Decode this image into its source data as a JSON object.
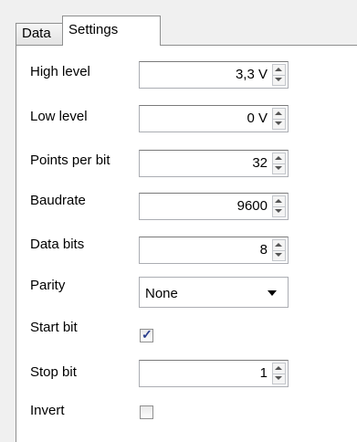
{
  "tabs": {
    "data": "Data",
    "settings": "Settings"
  },
  "settings": {
    "high_level": {
      "label": "High level",
      "value": "3,3 V"
    },
    "low_level": {
      "label": "Low level",
      "value": "0 V"
    },
    "points_per_bit": {
      "label": "Points per bit",
      "value": "32"
    },
    "baudrate": {
      "label": "Baudrate",
      "value": "9600"
    },
    "data_bits": {
      "label": "Data bits",
      "value": "8"
    },
    "parity": {
      "label": "Parity",
      "value": "None"
    },
    "start_bit": {
      "label": "Start bit",
      "checked": true
    },
    "stop_bit": {
      "label": "Stop bit",
      "value": "1"
    },
    "invert": {
      "label": "Invert",
      "checked": false
    }
  },
  "icons": {
    "spin_up": "spin-up-arrow-icon",
    "spin_down": "spin-down-arrow-icon",
    "dropdown": "chevron-down-icon",
    "check": "checkmark-icon"
  }
}
